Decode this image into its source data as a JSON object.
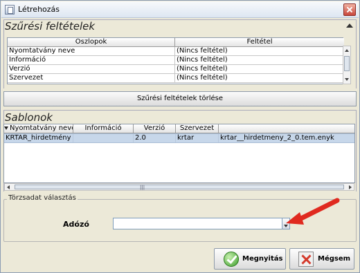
{
  "window": {
    "title": "Létrehozás"
  },
  "filter_section": {
    "heading": "Szűrési feltételek",
    "columns": [
      "Oszlopok",
      "Feltétel"
    ],
    "rows": [
      {
        "column": "Nyomtatvány neve",
        "condition": "(Nincs feltétel)"
      },
      {
        "column": "Információ",
        "condition": "(Nincs feltétel)"
      },
      {
        "column": "Verzió",
        "condition": "(Nincs feltétel)"
      },
      {
        "column": "Szervezet",
        "condition": "(Nincs feltétel)"
      }
    ],
    "clear_button": "Szűrési feltételek törlése"
  },
  "templates_section": {
    "heading": "Sablonok",
    "columns": [
      "Nyomtatvány neve",
      "Információ",
      "Verzió",
      "Szervezet",
      ""
    ],
    "rows": [
      {
        "name": "KRTAR_hirdetmény",
        "info": "",
        "version": "2.0",
        "org": "krtar",
        "file": "krtar__hirdetmeny_2_0.tem.enyk"
      }
    ]
  },
  "master_data": {
    "legend": "Törzsadat választás",
    "adozo_label": "Adózó",
    "adozo_value": ""
  },
  "buttons": {
    "open": "Megnyitás",
    "cancel": "Mégsem"
  },
  "colors": {
    "selected_row": "#c7d7ea",
    "annotation_arrow": "#e02a1f",
    "open_icon": "#3c9e2a",
    "cancel_icon": "#d43a2c"
  }
}
